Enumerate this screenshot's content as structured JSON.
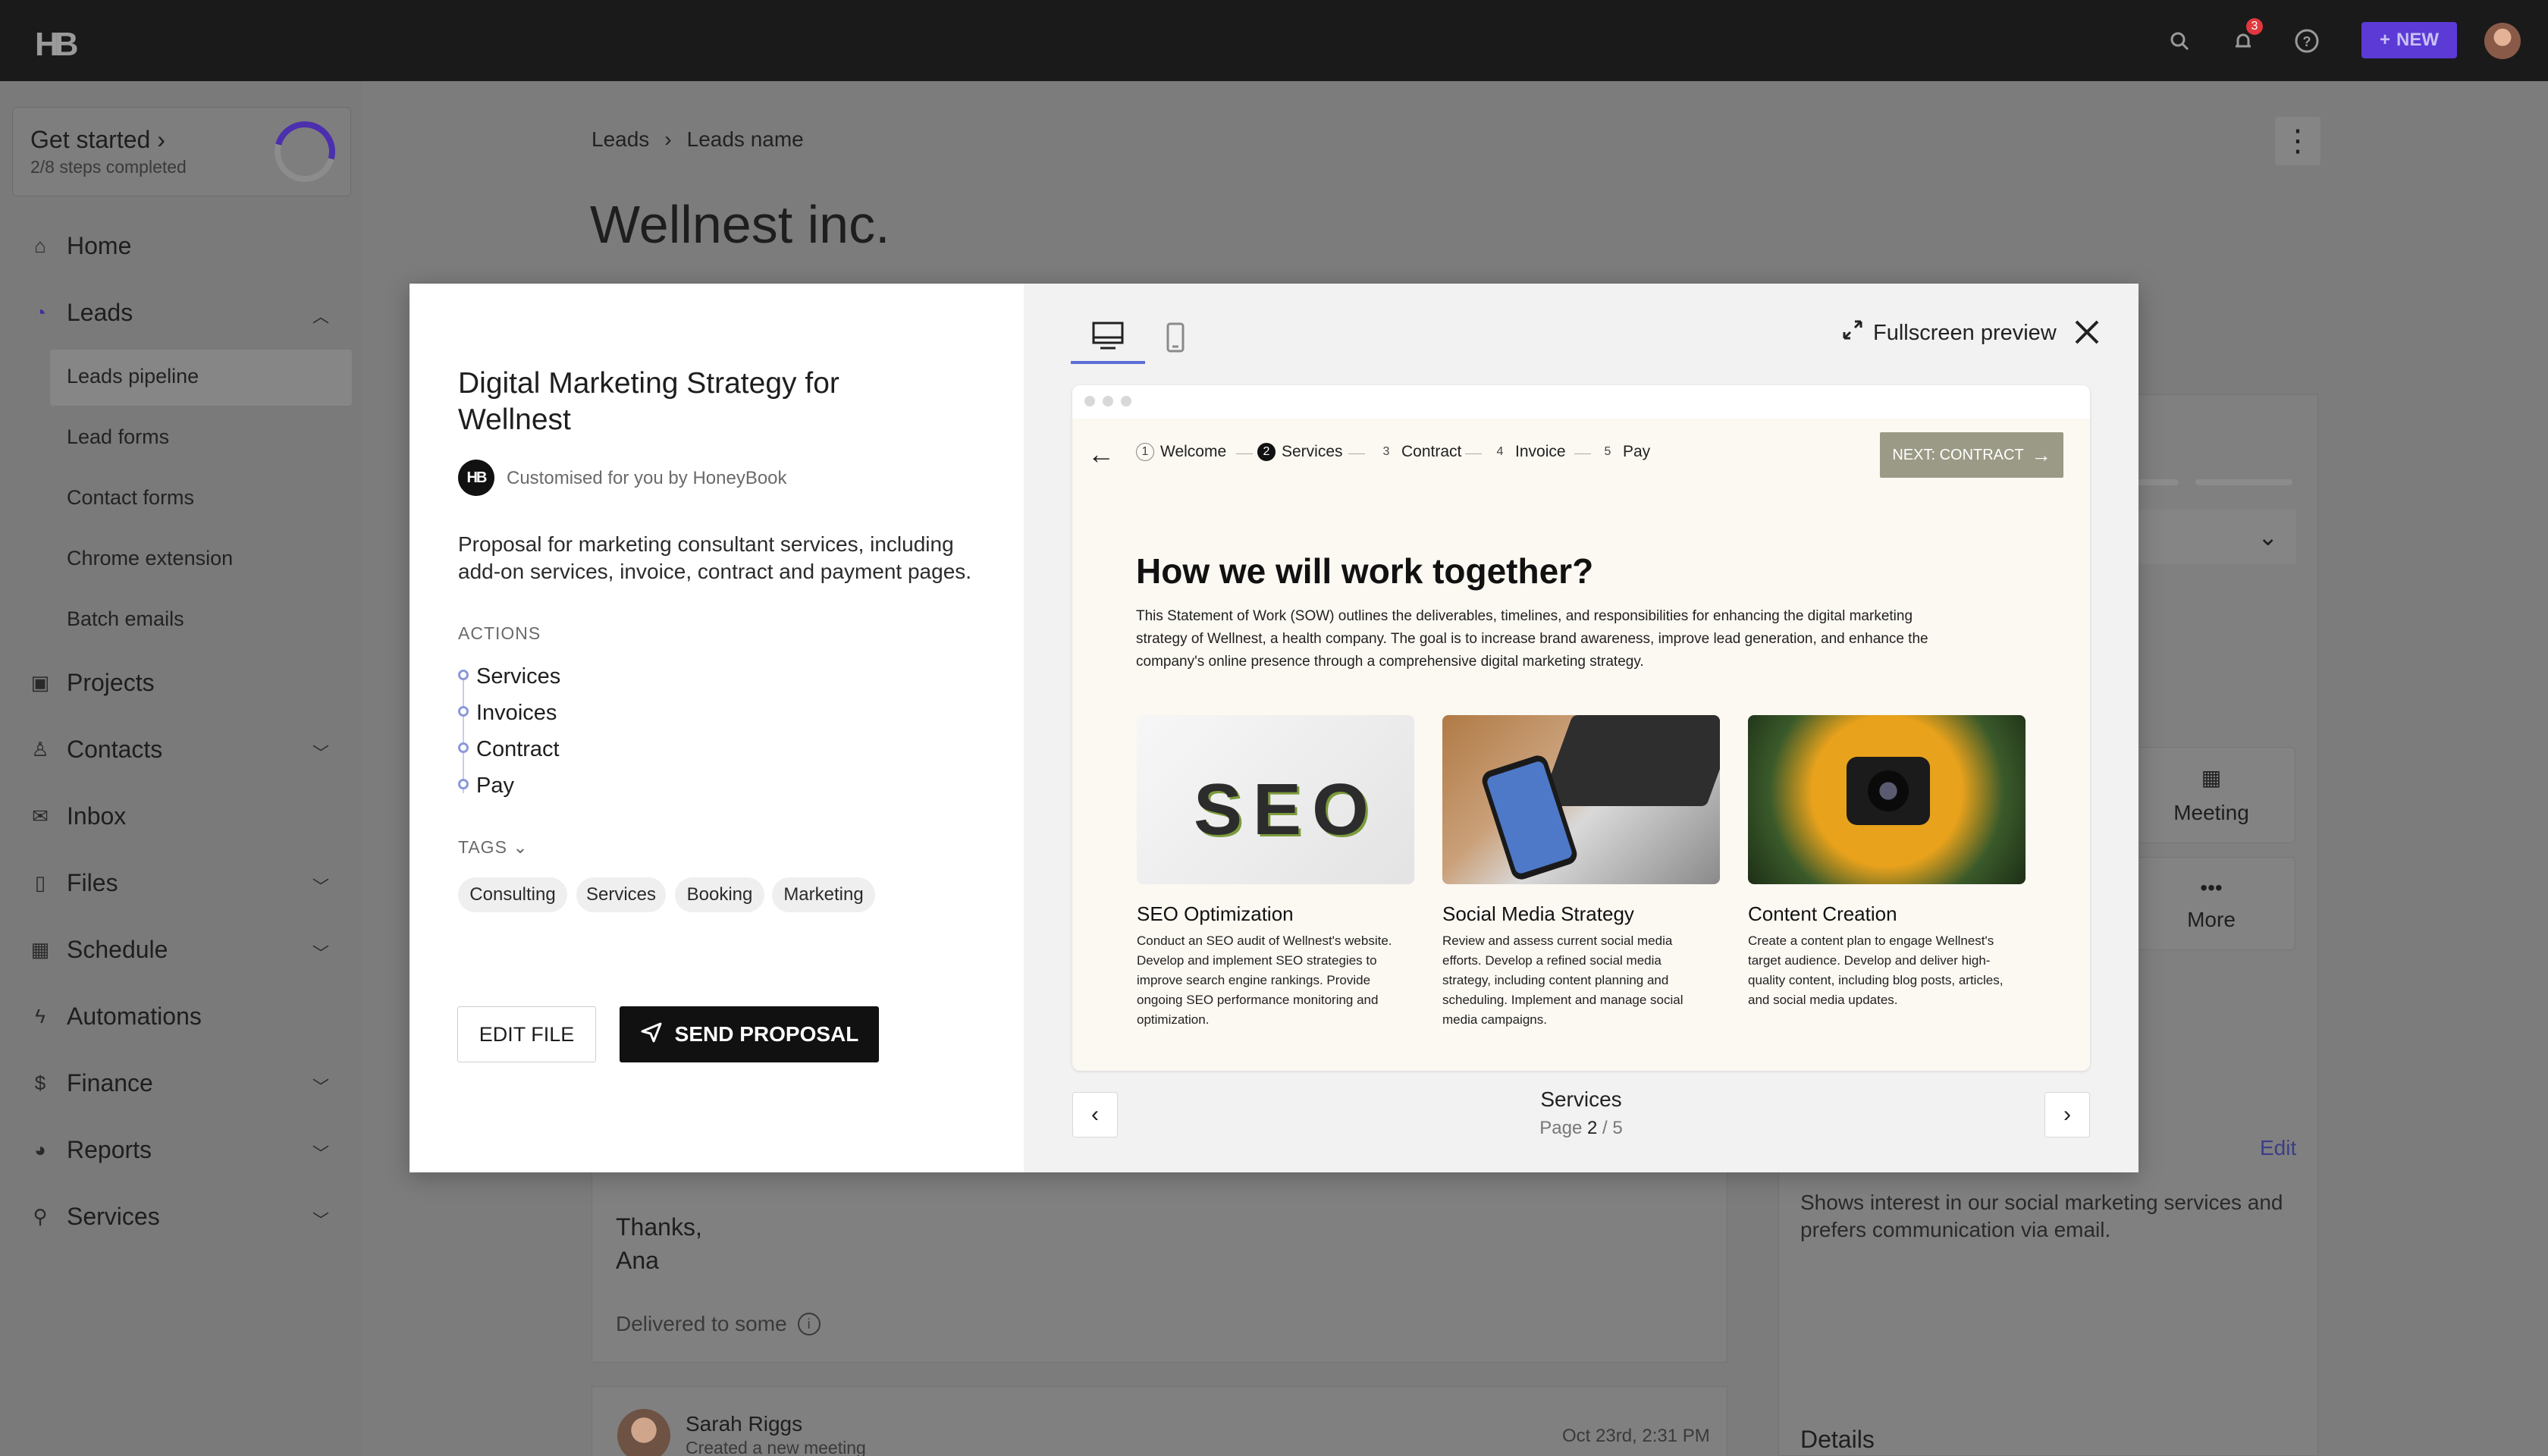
{
  "topbar": {
    "logo": "HB",
    "notification_count": "3",
    "new_button": "NEW",
    "icons": [
      "search-icon",
      "bell-icon",
      "help-icon"
    ]
  },
  "sidebar": {
    "get_started": {
      "title": "Get started",
      "subtitle": "2/8 steps completed",
      "progress": 0.25
    },
    "items": [
      {
        "label": "Home",
        "icon": "home-icon"
      },
      {
        "label": "Leads",
        "icon": "leads-icon",
        "expanded": true
      },
      {
        "label": "Projects",
        "icon": "briefcase-icon"
      },
      {
        "label": "Contacts",
        "icon": "person-icon"
      },
      {
        "label": "Inbox",
        "icon": "mail-icon"
      },
      {
        "label": "Files",
        "icon": "file-icon"
      },
      {
        "label": "Schedule",
        "icon": "calendar-icon"
      },
      {
        "label": "Automations",
        "icon": "bolt-icon"
      },
      {
        "label": "Finance",
        "icon": "dollar-icon"
      },
      {
        "label": "Reports",
        "icon": "chart-icon"
      },
      {
        "label": "Services",
        "icon": "services-icon"
      }
    ],
    "leads_subitems": [
      "Leads pipeline",
      "Lead forms",
      "Contact forms",
      "Chrome extension",
      "Batch emails"
    ]
  },
  "page": {
    "breadcrumb": [
      "Leads",
      "Leads name"
    ],
    "title": "Wellnest inc.",
    "tiles": {
      "meeting": "Meeting",
      "more": "More"
    },
    "edit_link": "Edit",
    "notes": "Shows interest in our social marketing services and prefers communication via email.",
    "details_heading": "Details",
    "email": {
      "thanks": "Thanks,",
      "signature": "Ana",
      "delivered": "Delivered to some"
    },
    "activity": {
      "name": "Sarah Riggs",
      "action": "Created a new meeting",
      "time": "Oct 23rd, 2:31 PM"
    }
  },
  "modal": {
    "title": "Digital Marketing Strategy for Wellnest",
    "hb_badge": "HB",
    "customised": "Customised for you by HoneyBook",
    "description": "Proposal for marketing consultant services, including add-on services, invoice, contract and payment pages.",
    "actions_label": "ACTIONS",
    "actions": [
      "Services",
      "Invoices",
      "Contract",
      "Pay"
    ],
    "tags_label": "TAGS",
    "tags": [
      "Consulting",
      "Services",
      "Booking",
      "Marketing"
    ],
    "edit_file": "EDIT FILE",
    "send_proposal": "SEND PROPOSAL",
    "fullscreen": "Fullscreen preview",
    "preview": {
      "steps": [
        {
          "num": "1",
          "label": "Welcome"
        },
        {
          "num": "2",
          "label": "Services",
          "active": true
        },
        {
          "num": "3",
          "label": "Contract"
        },
        {
          "num": "4",
          "label": "Invoice"
        },
        {
          "num": "5",
          "label": "Pay"
        }
      ],
      "next_button": "NEXT: CONTRACT",
      "heading": "How we will work together?",
      "intro": "This Statement of Work (SOW) outlines the deliverables, timelines, and responsibilities for enhancing the digital marketing strategy of Wellnest, a health company. The goal is to increase brand awareness, improve lead generation, and enhance the company's online presence through a comprehensive digital marketing strategy.",
      "seo_word": "SEO",
      "cards": [
        {
          "title": "SEO Optimization",
          "text": "Conduct an SEO audit of Wellnest's website. Develop and implement SEO strategies to improve search engine rankings. Provide ongoing SEO performance monitoring and optimization."
        },
        {
          "title": "Social Media Strategy",
          "text": "Review and assess current social media efforts. Develop a refined social media strategy, including content planning and scheduling. Implement and manage social media campaigns."
        },
        {
          "title": "Content Creation",
          "text": "Create a content plan to engage Wellnest's target audience. Develop and deliver high-quality content, including blog posts, articles, and social media updates."
        }
      ]
    },
    "pager": {
      "label": "Services",
      "prefix": "Page",
      "current": "2",
      "total": "/ 5"
    }
  }
}
